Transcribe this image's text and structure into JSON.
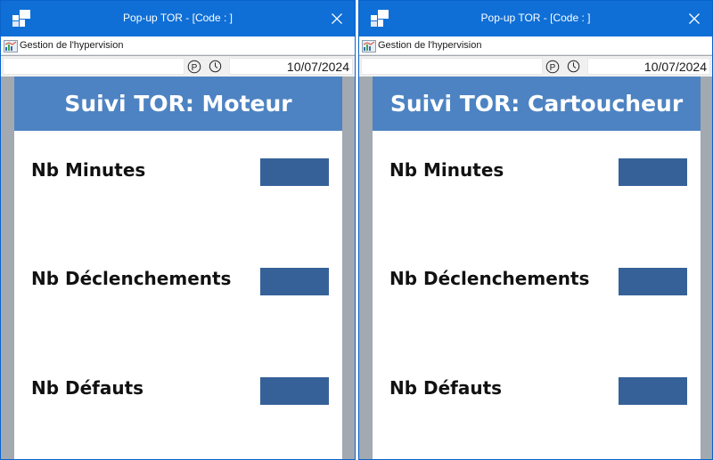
{
  "windows": [
    {
      "title": "Pop-up TOR - [Code : ]",
      "menu_label": "Gestion de l'hypervision",
      "toolbar": {
        "search_value": "",
        "p_label": "P",
        "date": "10/07/2024"
      },
      "panel": {
        "title": "Suivi TOR: Moteur",
        "rows": [
          {
            "label": "Nb Minutes",
            "value": ""
          },
          {
            "label": "Nb Déclenchements",
            "value": ""
          },
          {
            "label": "Nb Défauts",
            "value": ""
          }
        ]
      }
    },
    {
      "title": "Pop-up TOR - [Code : ]",
      "menu_label": "Gestion de l'hypervision",
      "toolbar": {
        "search_value": "",
        "p_label": "P",
        "date": "10/07/2024"
      },
      "panel": {
        "title": "Suivi TOR: Cartoucheur",
        "rows": [
          {
            "label": "Nb Minutes",
            "value": ""
          },
          {
            "label": "Nb Déclenchements",
            "value": ""
          },
          {
            "label": "Nb Défauts",
            "value": ""
          }
        ]
      }
    }
  ],
  "colors": {
    "titlebar": "#0f6fd6",
    "panel_header": "#4d83c2",
    "value_box": "#366198",
    "side_gutter": "#a2a9b0"
  },
  "icons": {
    "app": "tiles-logo-icon",
    "close": "close-icon",
    "menu": "hypervision-chart-icon",
    "p": "p-circle-icon",
    "clock": "clock-icon"
  }
}
